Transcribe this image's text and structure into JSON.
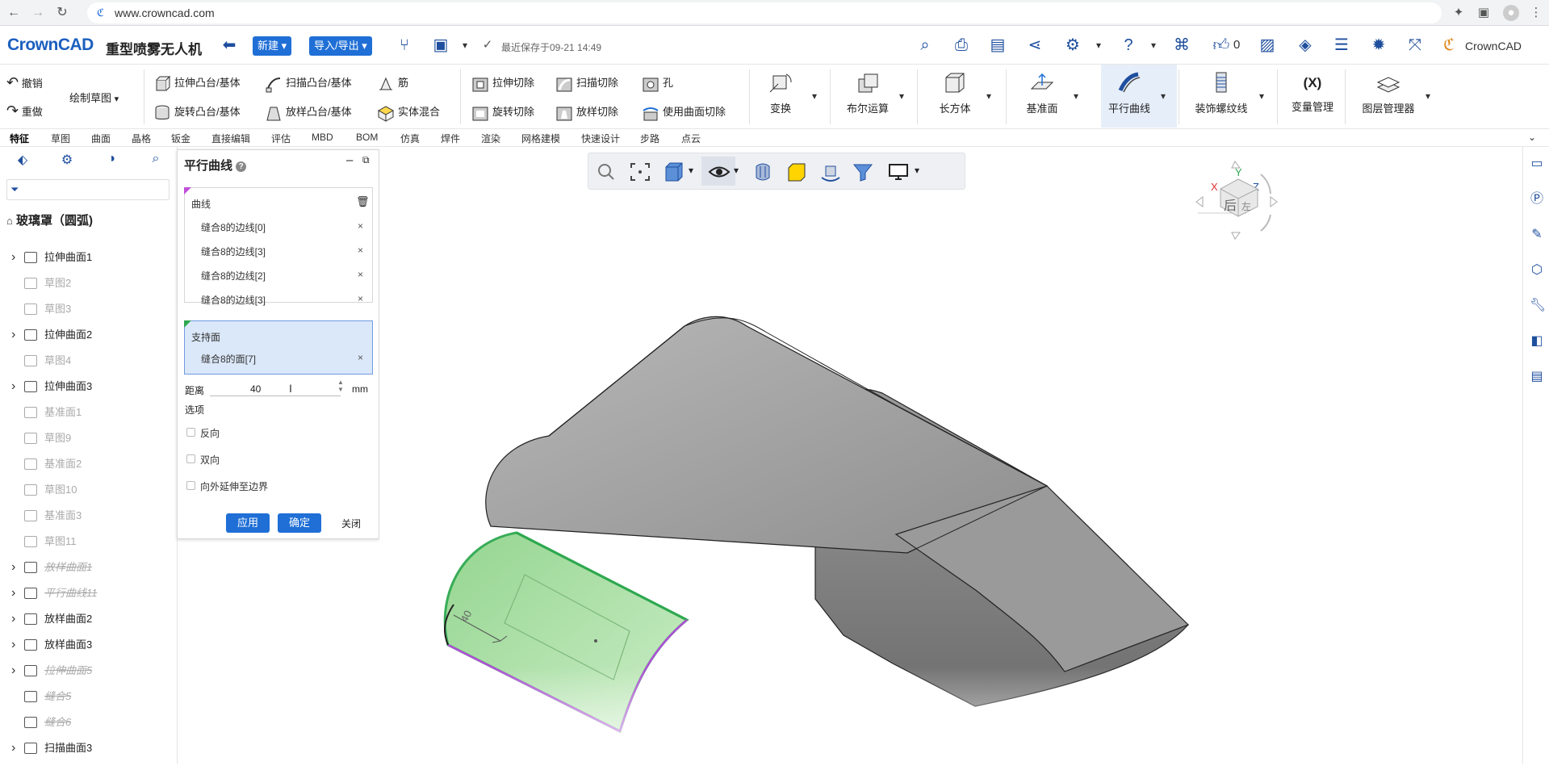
{
  "browser": {
    "url": "www.crowncad.com"
  },
  "header": {
    "logo": "CrownCAD",
    "doc_title": "重型喷雾无人机",
    "new_label": "新建",
    "import_export_label": "导入/导出",
    "save_status": "最近保存于09-21 14:49",
    "likes": "0",
    "brand_label": "CrownCAD"
  },
  "ribbon": {
    "undo": "撤销",
    "redo": "重做",
    "sketch": "绘制草图",
    "extrude_boss": "拉伸凸台/基体",
    "sweep_boss": "扫描凸台/基体",
    "rib": "筋",
    "revolve_boss": "旋转凸台/基体",
    "loft_boss": "放样凸台/基体",
    "solid_blend": "实体混合",
    "extrude_cut": "拉伸切除",
    "sweep_cut": "扫描切除",
    "hole": "孔",
    "revolve_cut": "旋转切除",
    "loft_cut": "放样切除",
    "surface_cut": "使用曲面切除",
    "transform": "变换",
    "boolean": "布尔运算",
    "box": "长方体",
    "datum_plane": "基准面",
    "parallel_curve": "平行曲线",
    "cosmetic_thread": "装饰螺纹线",
    "var_manager_icon": "(X)",
    "var_manager": "变量管理",
    "layer_manager": "图层管理器"
  },
  "tabs": [
    "特征",
    "草图",
    "曲面",
    "晶格",
    "钣金",
    "直接编辑",
    "评估",
    "MBD",
    "BOM",
    "仿真",
    "焊件",
    "渲染",
    "网格建模",
    "快速设计",
    "步路",
    "点云"
  ],
  "tree": {
    "root": "玻璃罩（圆弧)",
    "items": [
      {
        "label": "拉伸曲面1",
        "expand": true,
        "state": "normal"
      },
      {
        "label": "草图2",
        "expand": false,
        "state": "dim"
      },
      {
        "label": "草图3",
        "expand": false,
        "state": "dim"
      },
      {
        "label": "拉伸曲面2",
        "expand": true,
        "state": "normal"
      },
      {
        "label": "草图4",
        "expand": false,
        "state": "dim"
      },
      {
        "label": "拉伸曲面3",
        "expand": true,
        "state": "normal"
      },
      {
        "label": "基准面1",
        "expand": false,
        "state": "dim"
      },
      {
        "label": "草图9",
        "expand": false,
        "state": "dim"
      },
      {
        "label": "基准面2",
        "expand": false,
        "state": "dim"
      },
      {
        "label": "草图10",
        "expand": false,
        "state": "dim"
      },
      {
        "label": "基准面3",
        "expand": false,
        "state": "dim"
      },
      {
        "label": "草图11",
        "expand": false,
        "state": "dim"
      },
      {
        "label": "放样曲面1",
        "expand": true,
        "state": "struck"
      },
      {
        "label": "平行曲线11",
        "expand": true,
        "state": "struck"
      },
      {
        "label": "放样曲面2",
        "expand": true,
        "state": "normal"
      },
      {
        "label": "放样曲面3",
        "expand": true,
        "state": "normal"
      },
      {
        "label": "拉伸曲面5",
        "expand": true,
        "state": "struck"
      },
      {
        "label": "缝合5",
        "expand": false,
        "state": "struck"
      },
      {
        "label": "缝合6",
        "expand": false,
        "state": "struck"
      },
      {
        "label": "扫描曲面3",
        "expand": true,
        "state": "normal"
      }
    ]
  },
  "panel": {
    "title": "平行曲线",
    "curve_section": "曲线",
    "curves": [
      "缝合8的边线[0]",
      "缝合8的边线[3]",
      "缝合8的边线[2]",
      "缝合8的边线[3]"
    ],
    "support_section": "支持面",
    "support_faces": [
      "缝合8的面[7]"
    ],
    "distance_label": "距离",
    "distance_value": "40",
    "distance_unit": "mm",
    "options_label": "选项",
    "opt_reverse": "反向",
    "opt_both": "双向",
    "opt_extend": "向外延伸至边界",
    "apply": "应用",
    "ok": "确定",
    "close": "关闭"
  },
  "viewport": {
    "dim_label": "40",
    "view_cube_face": "后",
    "view_cube_side": "左",
    "axis_x": "X",
    "axis_y": "Y",
    "axis_z": "Z"
  },
  "colors": {
    "accent": "#1f6fd6",
    "highlight_face": "#8fd48a",
    "selection_edge": "#b04fd8"
  }
}
